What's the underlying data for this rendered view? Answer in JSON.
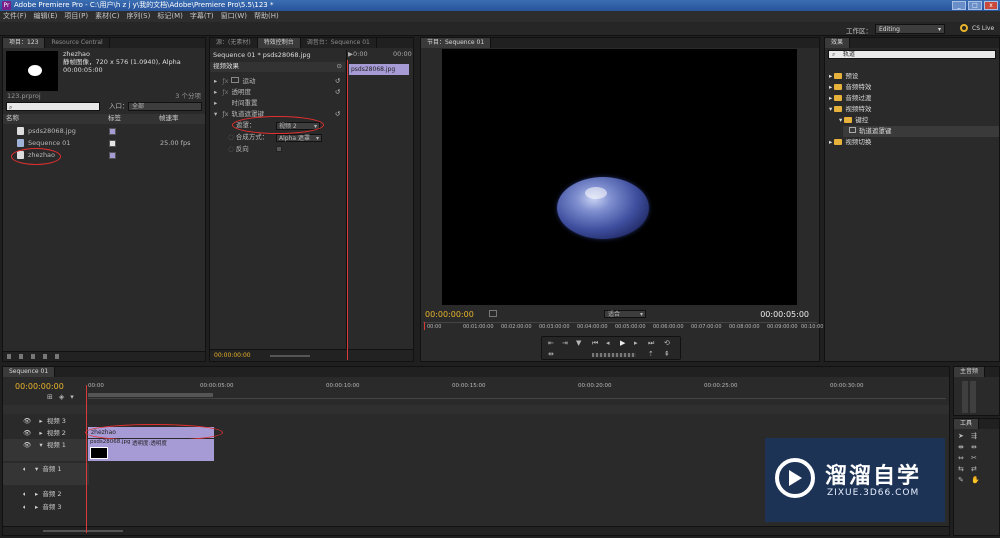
{
  "window": {
    "title": "Adobe Premiere Pro - C:\\用户\\h z j y\\我的文档\\Adobe\\Premiere Pro\\5.5\\123 *",
    "logo": "Pr",
    "min": "_",
    "max": "□",
    "close": "x"
  },
  "menu": [
    "文件(F)",
    "编辑(E)",
    "项目(P)",
    "素材(C)",
    "序列(S)",
    "标记(M)",
    "字幕(T)",
    "窗口(W)",
    "帮助(H)"
  ],
  "workspace": {
    "label": "工作区：",
    "value": "Editing",
    "cslive": "CS Live"
  },
  "project": {
    "tabs": [
      "项目：123",
      "Resource Central"
    ],
    "preview": {
      "name": "zhezhao",
      "line1": "静帧图像，720 x 576 (1.0940), Alpha",
      "line2": "00:00:05:00"
    },
    "file": "123.prproj",
    "count": "3 个分项",
    "entry_label": "入口：",
    "entry_value": "全部",
    "columns": [
      "名称",
      "标签",
      "帧速率"
    ],
    "items": [
      {
        "name": "psds28068.jpg",
        "rate": ""
      },
      {
        "name": "Sequence 01",
        "rate": "25.00 fps"
      },
      {
        "name": "zhezhao",
        "rate": ""
      }
    ]
  },
  "effect_controls": {
    "tabs": [
      "源：(无素材)",
      "特效控制台",
      "调音台：Sequence 01"
    ],
    "clip": "Sequence 01 * psds28068.jpg",
    "section": "视频效果",
    "mini_clip": "psds28068.jpg",
    "mini_time_start": "▶0:00",
    "mini_time_end": "00:00",
    "effects": [
      "运动",
      "透明度",
      "时间重置",
      "轨道遮罩键"
    ],
    "props": [
      {
        "label": "遮罩：",
        "value": "视频 2"
      },
      {
        "label": "合成方式：",
        "value": "Alpha 遮罩"
      },
      {
        "label": "反向",
        "value": ""
      }
    ],
    "timecode": "00:00:00:00"
  },
  "program": {
    "tab": "节目：Sequence 01",
    "timecode": "00:00:00:00",
    "duration": "00:00:05:00",
    "fit": "适合",
    "ruler": [
      "00:00",
      "00:01:00:00",
      "00:02:00:00",
      "00:03:00:00",
      "00:04:00:00",
      "00:05:00:00",
      "00:06:00:00",
      "00:07:00:00",
      "00:08:00:00",
      "00:09:00:00",
      "00:10:00:00"
    ]
  },
  "effects_panel": {
    "tab": "效果",
    "search": "轨道",
    "tree": [
      {
        "label": "预设",
        "indent": 0
      },
      {
        "label": "音频特效",
        "indent": 0
      },
      {
        "label": "音频过渡",
        "indent": 0
      },
      {
        "label": "视频特效",
        "indent": 0
      },
      {
        "label": "键控",
        "indent": 1
      },
      {
        "label": "轨道遮罩键",
        "indent": 2
      },
      {
        "label": "视频切换",
        "indent": 0
      }
    ]
  },
  "timeline": {
    "tab": "Sequence 01",
    "timecode": "00:00:00:00",
    "ruler": [
      "00:00",
      "00:00:05:00",
      "00:00:10:00",
      "00:00:15:00",
      "00:00:20:00",
      "00:00:25:00",
      "00:00:30:00"
    ],
    "tracks": [
      "视频 3",
      "视频 2",
      "视频 1",
      "音频 1",
      "音频 2",
      "音频 3"
    ],
    "clip_v2": "zhezhao",
    "clip_v1": "psds28068.jpg",
    "clip_v1_fx": "透明度:透明度"
  },
  "master": {
    "tab": "主音频"
  },
  "tools": {
    "tab": "工具"
  },
  "watermark": {
    "brand": "溜溜自学",
    "url": "ZIXUE.3D66.COM"
  },
  "colors": {
    "playhead": "#d93b3b",
    "timecode": "#e8b42a",
    "annotation": "#e32f2f",
    "clip": "#a79bd6"
  }
}
